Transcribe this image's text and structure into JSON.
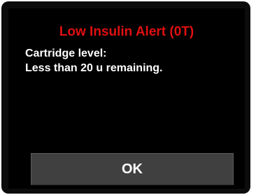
{
  "alert": {
    "title": "Low Insulin Alert (0T)",
    "title_color": "#e01010",
    "message_lines": [
      "Cartridge level:",
      "Less than 20 u remaining."
    ]
  },
  "buttons": {
    "ok_label": "OK"
  }
}
